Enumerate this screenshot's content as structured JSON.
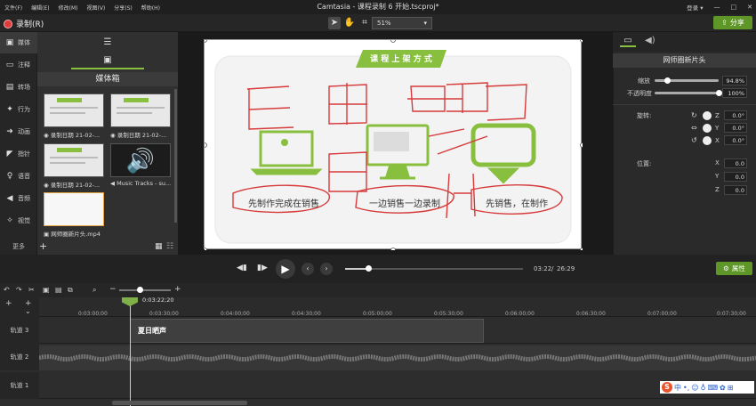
{
  "menu": [
    "文件(F)",
    "编辑(E)",
    "修改(M)",
    "视图(V)",
    "分享(S)",
    "帮助(H)"
  ],
  "app_title": "Camtasia - 课程录制 6 开始.tscproj*",
  "account": "登录 ▾",
  "window_controls": {
    "minimize": "—",
    "maximize": "□",
    "close": "✕"
  },
  "record_label": "录制(R)",
  "zoom_value": "51%",
  "share_label": "分享",
  "nav_items": [
    {
      "label": "媒体",
      "icon": "film-icon",
      "glyph": "▣"
    },
    {
      "label": "注释",
      "icon": "annotation-icon",
      "glyph": "▭"
    },
    {
      "label": "转场",
      "icon": "transition-icon",
      "glyph": "▤"
    },
    {
      "label": "行为",
      "icon": "behavior-icon",
      "glyph": "✦"
    },
    {
      "label": "动画",
      "icon": "animation-icon",
      "glyph": "➜"
    },
    {
      "label": "指针",
      "icon": "cursor-icon",
      "glyph": "◤"
    },
    {
      "label": "语音",
      "icon": "mic-icon",
      "glyph": "♀"
    },
    {
      "label": "音频",
      "icon": "speaker-icon",
      "glyph": "◀"
    },
    {
      "label": "视觉",
      "icon": "visual-icon",
      "glyph": "✧"
    }
  ],
  "nav_more": "更多",
  "bin_title": "媒体箱",
  "bin_items": [
    {
      "caption": "录制日期 21-02-..."
    },
    {
      "caption": "录制日期 21-02-..."
    },
    {
      "caption": "录制日期 21-02-..."
    },
    {
      "caption": "Music Tracks - su..."
    },
    {
      "caption": "网师圈新片头.mp4"
    }
  ],
  "slide": {
    "banner": "课 程 上 架 方 式",
    "captions": [
      "先制作完成在销售",
      "一边销售一边录制",
      "先销售，在制作"
    ]
  },
  "colors": {
    "accent": "#88bf3e",
    "annotation": "#d63a3a",
    "share": "#5e9628"
  },
  "props": {
    "title": "网师圈新片头",
    "scale_label": "缩放",
    "scale_value": "94.8%",
    "scale_fraction": 0.2,
    "opacity_label": "不透明度",
    "opacity_value": "100%",
    "opacity_fraction": 1.0,
    "rotation_label": "旋转:",
    "rotation": [
      {
        "axis": "Z",
        "value": "0.0°"
      },
      {
        "axis": "Y",
        "value": "0.0°"
      },
      {
        "axis": "X",
        "value": "0.0°"
      }
    ],
    "position_label": "位置:",
    "position": [
      {
        "axis": "X",
        "value": "0.0"
      },
      {
        "axis": "Y",
        "value": "0.0"
      },
      {
        "axis": "Z",
        "value": "0.0"
      }
    ]
  },
  "playback": {
    "current": "03:22",
    "separator": "/",
    "total": "26:29",
    "progress_fraction": 0.13
  },
  "properties_button": "属性",
  "timeline": {
    "playhead_time": "0:03:22;20",
    "ticks": [
      "0:03:00;00",
      "0:03:30;00",
      "0:04:00;00",
      "0:04:30;00",
      "0:05:00;00",
      "0:05:30;00",
      "0:06:00;00",
      "0:06:30;00",
      "0:07:00;00",
      "0:07:30;00"
    ],
    "tracks": [
      "轨道 3",
      "轨道 2",
      "轨道 1"
    ],
    "clip_track3": "夏日晒声"
  },
  "ime": {
    "logo": "S",
    "items": [
      "中",
      "•,",
      "☺",
      "♁",
      "⌨",
      "✿",
      "⊞"
    ]
  }
}
